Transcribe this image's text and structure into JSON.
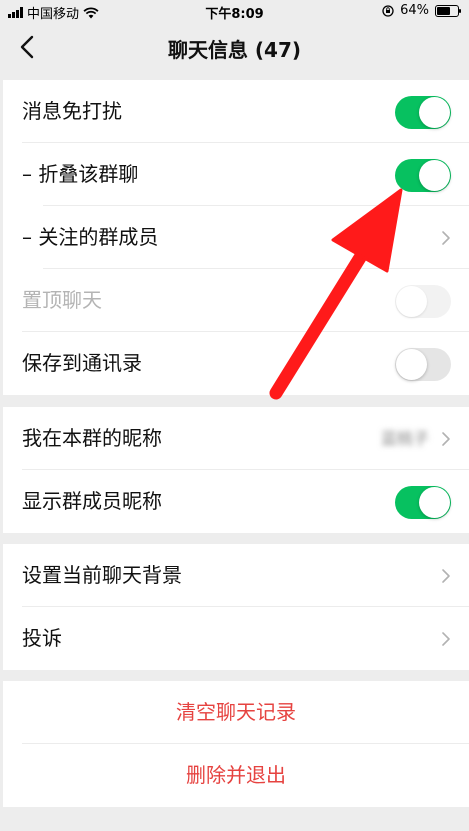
{
  "status_bar": {
    "carrier": "中国移动",
    "time": "下午8:09",
    "battery_text": "64%",
    "battery_level": 0.64,
    "icons": [
      "signal-icon",
      "wifi-icon",
      "orientation-lock-icon",
      "battery-icon"
    ]
  },
  "nav": {
    "title": "聊天信息 (47)",
    "back_icon": "chevron-left-icon"
  },
  "group1": {
    "mute": {
      "label": "消息免打扰",
      "on": true
    },
    "fold": {
      "label": "– 折叠该群聊",
      "on": true
    },
    "follow": {
      "label": "– 关注的群成员"
    },
    "pin": {
      "label": "置顶聊天",
      "on": false,
      "disabled": true
    },
    "save": {
      "label": "保存到通讯录",
      "on": false
    }
  },
  "group2": {
    "nickname": {
      "label": "我在本群的昵称",
      "value": "蓝桃子"
    },
    "show_nicknames": {
      "label": "显示群成员昵称",
      "on": true
    }
  },
  "group3": {
    "background": {
      "label": "设置当前聊天背景"
    },
    "complain": {
      "label": "投诉"
    }
  },
  "actions": {
    "clear": "清空聊天记录",
    "exit": "删除并退出"
  },
  "colors": {
    "toggle_on": "#07c160",
    "danger": "#e64340",
    "annotation_arrow": "#ff1a1a"
  }
}
